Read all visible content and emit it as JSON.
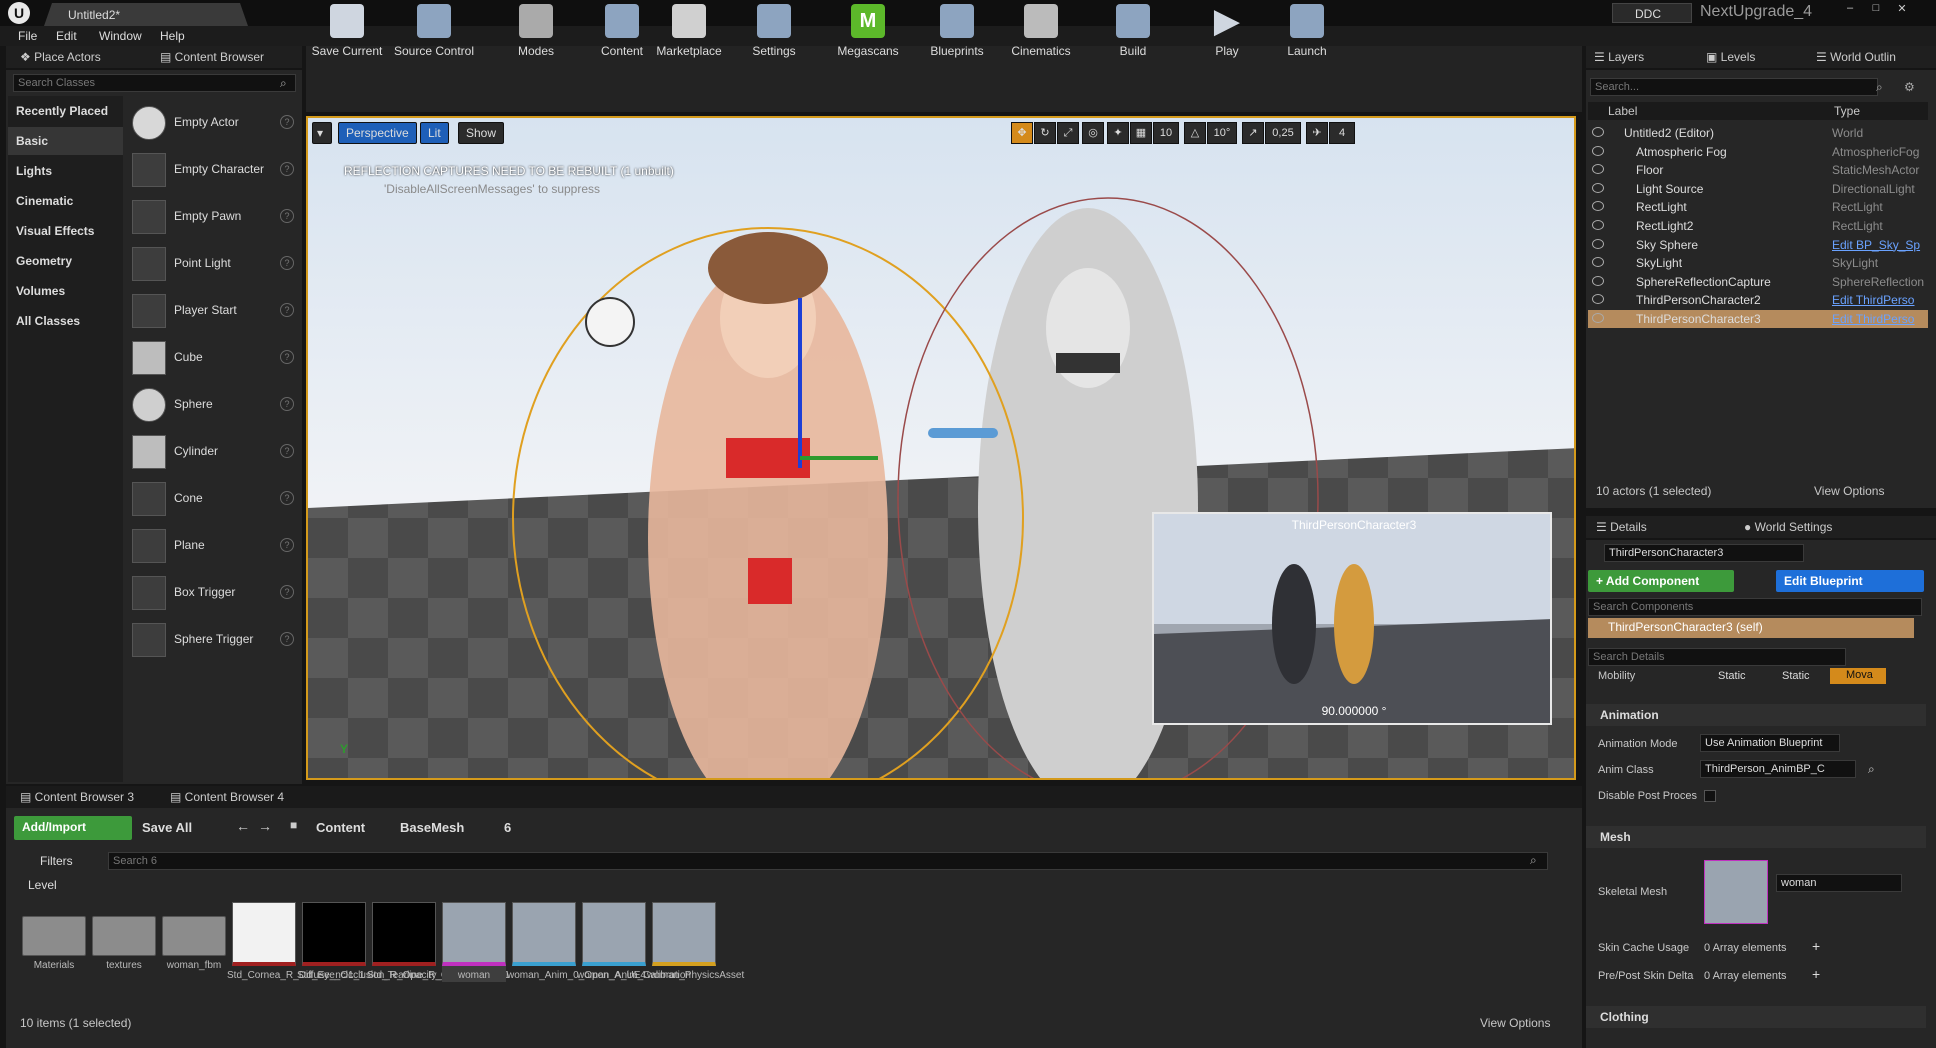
{
  "window": {
    "doc_tab": "Untitled2*",
    "ddc": "DDC",
    "project": "NextUpgrade_4",
    "menu": [
      "File",
      "Edit",
      "Window",
      "Help"
    ]
  },
  "left_tabs": {
    "place_actors": "Place Actors",
    "content_browser": "Content Browser"
  },
  "place_actors": {
    "search_placeholder": "Search Classes",
    "categories": [
      "Recently Placed",
      "Basic",
      "Lights",
      "Cinematic",
      "Visual Effects",
      "Geometry",
      "Volumes",
      "All Classes"
    ],
    "actors": [
      "Empty Actor",
      "Empty Character",
      "Empty Pawn",
      "Point Light",
      "Player Start",
      "Cube",
      "Sphere",
      "Cylinder",
      "Cone",
      "Plane",
      "Box Trigger",
      "Sphere Trigger"
    ]
  },
  "toolbar": [
    "Save Current",
    "Source Control",
    "Modes",
    "Content",
    "Marketplace",
    "Settings",
    "Megascans",
    "Blueprints",
    "Cinematics",
    "Build",
    "Play",
    "Launch"
  ],
  "viewport": {
    "perspective": "Perspective",
    "lit": "Lit",
    "show": "Show",
    "warning": "REFLECTION CAPTURES NEED TO BE REBUILT (1 unbuilt)",
    "suppress": "'DisableAllScreenMessages' to suppress",
    "grid": "10",
    "angle": "10°",
    "scale": "0,25",
    "cam_speed": "4",
    "preview_title": "ThirdPersonCharacter3",
    "preview_fov": "90.000000 °",
    "axis_y": "Y"
  },
  "outliner": {
    "tabs": [
      "Layers",
      "Levels",
      "World Outlin"
    ],
    "search_placeholder": "Search...",
    "col_label": "Label",
    "col_type": "Type",
    "rows": [
      {
        "label": "Untitled2 (Editor)",
        "type": "World",
        "link": false
      },
      {
        "label": "Atmospheric Fog",
        "type": "AtmosphericFog",
        "link": false
      },
      {
        "label": "Floor",
        "type": "StaticMeshActor",
        "link": false
      },
      {
        "label": "Light Source",
        "type": "DirectionalLight",
        "link": false
      },
      {
        "label": "RectLight",
        "type": "RectLight",
        "link": false
      },
      {
        "label": "RectLight2",
        "type": "RectLight",
        "link": false
      },
      {
        "label": "Sky Sphere",
        "type": "Edit BP_Sky_Sp",
        "link": true
      },
      {
        "label": "SkyLight",
        "type": "SkyLight",
        "link": false
      },
      {
        "label": "SphereReflectionCapture",
        "type": "SphereReflection",
        "link": false
      },
      {
        "label": "ThirdPersonCharacter2",
        "type": "Edit ThirdPerso",
        "link": true
      },
      {
        "label": "ThirdPersonCharacter3",
        "type": "Edit ThirdPerso",
        "link": true
      }
    ],
    "status": "10 actors (1 selected)",
    "view_options": "View Options"
  },
  "details": {
    "tabs": [
      "Details",
      "World Settings"
    ],
    "name": "ThirdPersonCharacter3",
    "add_component": "+ Add Component",
    "edit_blueprint": "Edit Blueprint",
    "search_components": "Search Components",
    "self": "ThirdPersonCharacter3 (self)",
    "search_details": "Search Details",
    "mobility": "Mobility",
    "mobility_opts": [
      "Static",
      "Static",
      "Mova"
    ],
    "animation": "Animation",
    "anim_mode_label": "Animation Mode",
    "anim_mode": "Use Animation Blueprint",
    "anim_class_label": "Anim Class",
    "anim_class": "ThirdPerson_AnimBP_C",
    "disable_post": "Disable Post Proces",
    "mesh": "Mesh",
    "skeletal_mesh": "Skeletal Mesh",
    "mesh_value": "woman",
    "skin_cache": "Skin Cache Usage",
    "skin_cache_val": "0 Array elements",
    "pre_post": "Pre/Post Skin Delta",
    "pre_post_val": "0 Array elements",
    "clothing": "Clothing"
  },
  "content_browser": {
    "tabs": [
      "Content Browser 3",
      "Content Browser 4"
    ],
    "add_import": "Add/Import",
    "save_all": "Save All",
    "path": [
      "Content",
      "BaseMesh",
      "6"
    ],
    "filters": "Filters",
    "search_placeholder": "Search 6",
    "level": "Level",
    "assets": [
      {
        "name": "Materials",
        "kind": "folder"
      },
      {
        "name": "textures",
        "kind": "folder"
      },
      {
        "name": "woman_fbm",
        "kind": "folder"
      },
      {
        "name": "Std_Cornea_R_Diffuse_ncl1_1",
        "kind": "tex-white"
      },
      {
        "name": "Std_Eye_Occlusion_R_Opacity_ncl1",
        "kind": "tex-black"
      },
      {
        "name": "Std_Tearline_R_Opacity_ncl1_1",
        "kind": "tex-black"
      },
      {
        "name": "woman",
        "kind": "mesh"
      },
      {
        "name": "woman_Anim_0_Open_A_UE4",
        "kind": "anim"
      },
      {
        "name": "woman_Anim_Calibration",
        "kind": "anim"
      },
      {
        "name": "woman_PhysicsAsset",
        "kind": "phys"
      }
    ],
    "status": "10 items (1 selected)",
    "view_options": "View Options"
  },
  "colors": {
    "accent": "#d49a1b",
    "green": "#3d9a3b",
    "blue": "#1e6fd9",
    "selection": "#b58b5d"
  }
}
